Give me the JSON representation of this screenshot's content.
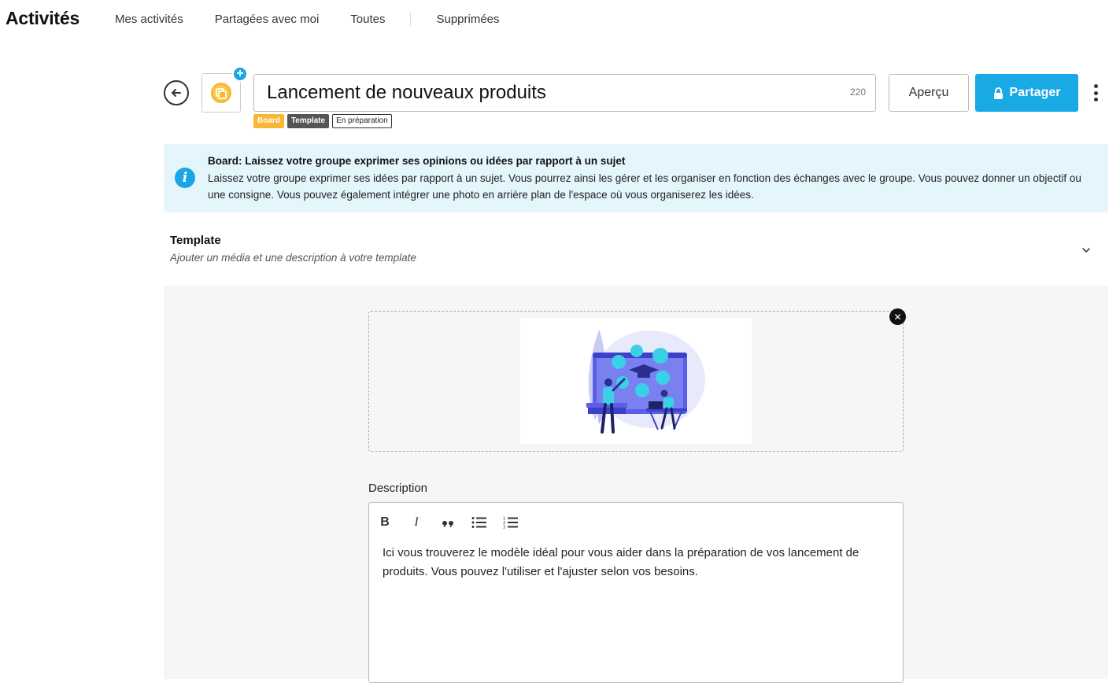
{
  "app": {
    "title": "Activités"
  },
  "nav": {
    "tabs": [
      {
        "label": "Mes activités"
      },
      {
        "label": "Partagées avec moi"
      },
      {
        "label": "Toutes"
      },
      {
        "label": "Supprimées"
      }
    ]
  },
  "header": {
    "title_value": "Lancement de nouveaux produits",
    "char_count": "220",
    "preview_label": "Aperçu",
    "share_label": "Partager",
    "tags": {
      "board": "Board",
      "template": "Template",
      "status": "En préparation"
    }
  },
  "info": {
    "title": "Board: Laissez votre groupe exprimer ses opinions ou idées par rapport à un sujet",
    "text": "Laissez votre groupe exprimer ses idées par rapport à un sujet. Vous pourrez ainsi les gérer et les organiser en fonction des échanges avec le groupe. Vous pouvez donner un objectif ou une consigne. Vous pouvez également intégrer une photo en arrière plan de l'espace où vous organiserez les idées."
  },
  "template": {
    "title": "Template",
    "subtitle": "Ajouter un média et une description à votre template"
  },
  "description": {
    "label": "Description",
    "text": "Ici vous trouverez le modèle idéal pour vous aider dans la préparation de vos lancement de produits. Vous pouvez l'utiliser et l'ajuster selon vos besoins."
  },
  "colors": {
    "accent": "#19a9e5",
    "board_tag": "#f7b731",
    "template_tag": "#555555",
    "info_bg": "#e4f5fc"
  },
  "icons": [
    "back-arrow-icon",
    "activity-icon",
    "plus-icon",
    "lock-icon",
    "more-vertical-icon",
    "info-icon",
    "chevron-down-icon",
    "close-icon",
    "bold-icon",
    "italic-icon",
    "quote-icon",
    "bullet-list-icon",
    "numbered-list-icon"
  ]
}
